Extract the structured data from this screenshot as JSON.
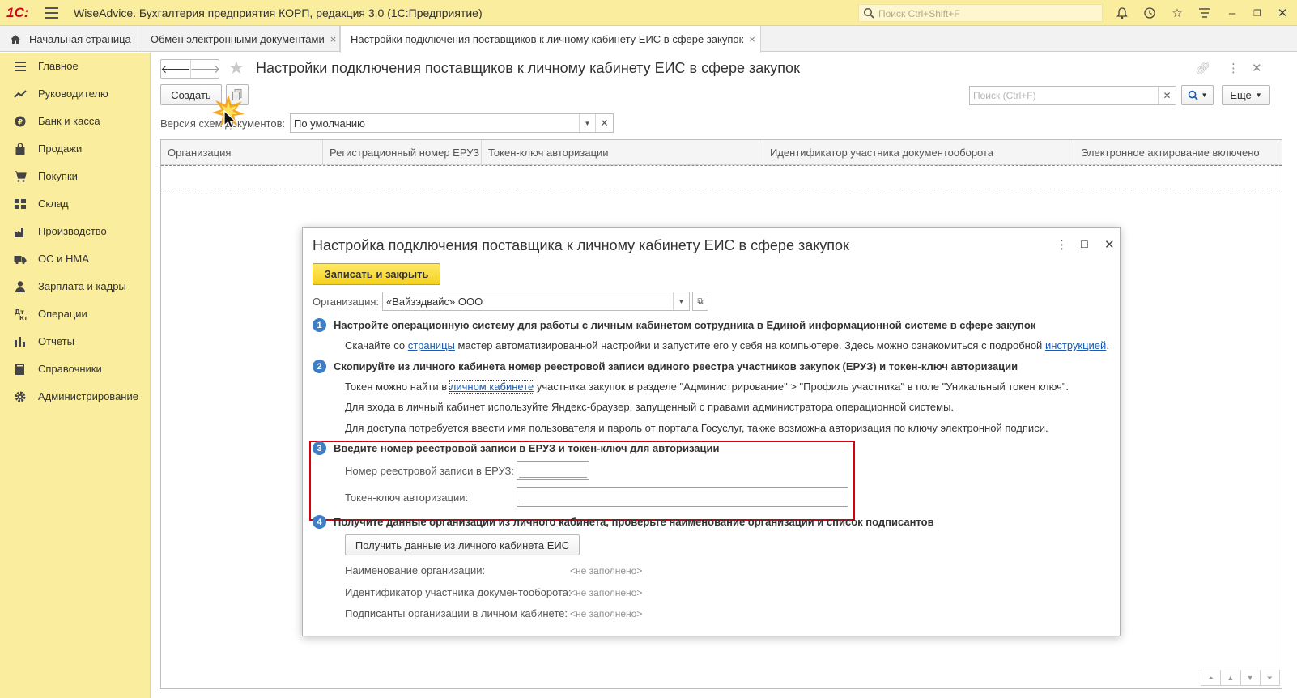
{
  "titlebar": {
    "logo": "1С:",
    "app_title": "WiseAdvice. Бухгалтерия предприятия КОРП, редакция 3.0  (1С:Предприятие)",
    "search_placeholder": "Поиск Ctrl+Shift+F",
    "bg_color": "#fbed9e"
  },
  "tabs": [
    {
      "label": "Начальная страница"
    },
    {
      "label": "Обмен электронными документами",
      "close": "×"
    },
    {
      "label": "Настройки подключения поставщиков к личному кабинету ЕИС в сфере закупок",
      "close": "×"
    }
  ],
  "sidebar": {
    "items": [
      {
        "label": "Главное",
        "icon": "menu-lines-icon"
      },
      {
        "label": "Руководителю",
        "icon": "trend-icon"
      },
      {
        "label": "Банк и касса",
        "icon": "coin-icon"
      },
      {
        "label": "Продажи",
        "icon": "bag-icon"
      },
      {
        "label": "Покупки",
        "icon": "cart-icon"
      },
      {
        "label": "Склад",
        "icon": "warehouse-icon"
      },
      {
        "label": "Производство",
        "icon": "factory-icon"
      },
      {
        "label": "ОС и НМА",
        "icon": "truck-icon"
      },
      {
        "label": "Зарплата и кадры",
        "icon": "person-icon"
      },
      {
        "label": "Операции",
        "icon": "operations-icon"
      },
      {
        "label": "Отчеты",
        "icon": "bar-chart-icon"
      },
      {
        "label": "Справочники",
        "icon": "book-icon"
      },
      {
        "label": "Администрирование",
        "icon": "gear-icon"
      }
    ]
  },
  "form": {
    "title": "Настройки подключения поставщиков к личному кабинету ЕИС в сфере закупок",
    "create_label": "Создать",
    "search_placeholder": "Поиск (Ctrl+F)",
    "more_label": "Еще",
    "version_label": "Версия схем документов:",
    "version_value": "По умолчанию",
    "columns": [
      "Организация",
      "Регистрационный номер ЕРУЗ",
      "Токен-ключ авторизации",
      "Идентификатор участника документооборота",
      "Электронное актирование включено"
    ]
  },
  "dialog": {
    "title": "Настройка подключения поставщика к личному кабинету ЕИС в сфере закупок",
    "save_close_label": "Записать и закрыть",
    "org_label": "Организация:",
    "org_value": "«Вайзэдвайс» ООО",
    "step1": {
      "num": "1",
      "head": "Настройте операционную систему для работы с личным кабинетом сотрудника в Единой информационной системе в сфере закупок",
      "t_pre": "Скачайте со ",
      "link1": "страницы",
      "t_mid": " мастер автоматизированной настройки и запустите его у себя на компьютере. Здесь можно ознакомиться с подробной ",
      "link2": "инструкцией",
      "t_end": "."
    },
    "step2": {
      "num": "2",
      "head": "Скопируйте из личного кабинета номер реестровой записи единого реестра участников закупок (ЕРУЗ) и токен-ключ авторизации",
      "t1_pre": "Токен можно найти в ",
      "t1_link": "личном кабинете",
      "t1_end": " участника закупок в разделе \"Администрирование\" > \"Профиль участника\" в поле \"Уникальный токен ключ\".",
      "t2": "Для входа в личный кабинет используйте Яндекс-браузер, запущенный с правами администратора операционной системы.",
      "t3": "Для доступа потребуется ввести имя пользователя и пароль от портала Госуслуг, также возможна авторизация по ключу электронной подписи."
    },
    "step3": {
      "num": "3",
      "head": "Введите номер реестровой записи в ЕРУЗ и токен-ключ для авторизации",
      "reg_label": "Номер реестровой записи в ЕРУЗ:",
      "reg_value": "",
      "token_label": "Токен-ключ авторизации:",
      "token_value": ""
    },
    "step4": {
      "num": "4",
      "head": "Получите данные организации из личного кабинета, проверьте наименование организации и список подписантов",
      "button": "Получить данные из личного кабинета ЕИС",
      "name_label": "Наименование организации:",
      "id_label": "Идентификатор участника документооборота:",
      "signers_label": "Подписанты организации в личном кабинете:",
      "empty": "<не заполнено>"
    },
    "highlight_color": "#d7000f"
  }
}
